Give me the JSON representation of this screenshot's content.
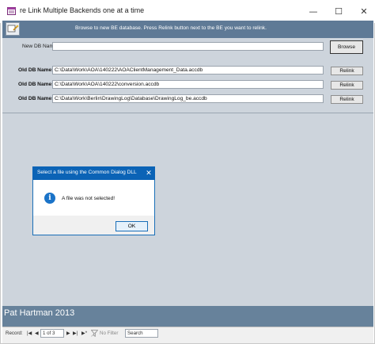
{
  "window": {
    "title": "re Link Multiple Backends one at a time",
    "minimize_glyph": "—",
    "maximize_glyph": "☐",
    "close_glyph": "✕"
  },
  "header": {
    "instructions": "Browse to new BE database.  Press Relink button next to the BE you want to relink."
  },
  "new_db": {
    "label": "New DB Name:",
    "value": "",
    "browse_label": "Browse"
  },
  "old_dbs": [
    {
      "label": "Old DB Name:",
      "path": "C:\\Data\\Work\\AOA\\140222\\AOAClientManagement_Data.accdb",
      "button": "Relink"
    },
    {
      "label": "Old DB Name:",
      "path": "C:\\Data\\Work\\AOA\\140222\\conversion.accdb",
      "button": "Relink"
    },
    {
      "label": "Old DB Name:",
      "path": "C:\\Data\\Work\\Berlin\\DrawingLog\\Database\\DrawingLog_be.accdb",
      "button": "Relink"
    }
  ],
  "footer": {
    "text": "Pat Hartman 2013"
  },
  "dialog": {
    "title": "Select a file using the Common Dialog DLL",
    "message": "A file was not selected!",
    "ok_label": "OK",
    "icon_glyph": "i",
    "close_glyph": "✕"
  },
  "navigation": {
    "record_label": "Record:",
    "first": "|◀",
    "prev": "◀",
    "position": "1 of 3",
    "next": "▶",
    "last": "▶|",
    "new": "▶*",
    "filter_label": "No Filter",
    "search_label": "Search"
  },
  "colors": {
    "form_header": "#5f7a96",
    "form_body": "#cdd4dc",
    "footer": "#67829b",
    "dialog_title": "#0b63b6"
  }
}
